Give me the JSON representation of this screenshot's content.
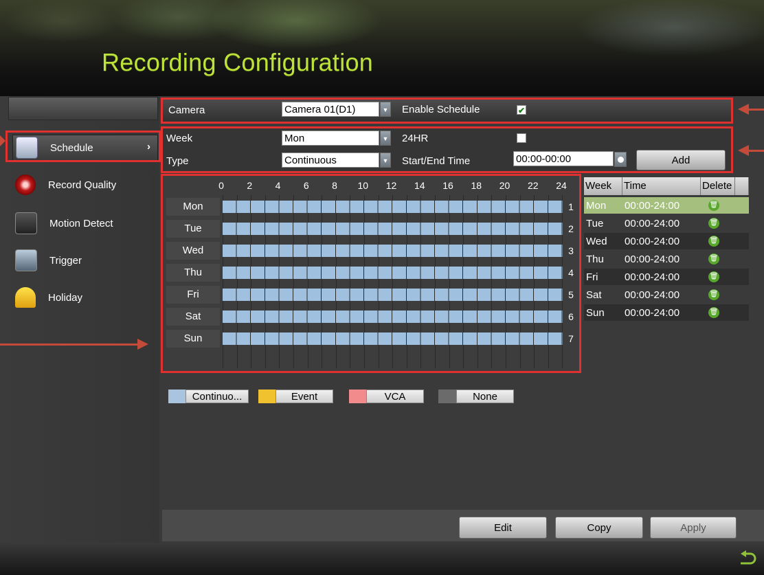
{
  "title": "Recording Configuration",
  "sidebar": {
    "items": [
      {
        "label": "Schedule",
        "icon": "calendar-icon"
      },
      {
        "label": "Record Quality",
        "icon": "record-icon"
      },
      {
        "label": "Motion Detect",
        "icon": "motion-icon"
      },
      {
        "label": "Trigger",
        "icon": "trigger-icon"
      },
      {
        "label": "Holiday",
        "icon": "umbrella-icon"
      }
    ]
  },
  "camera_row": {
    "camera_label": "Camera",
    "camera_value": "Camera 01(D1)",
    "enable_label": "Enable Schedule",
    "enable_checked": true
  },
  "schedule_row": {
    "week_label": "Week",
    "week_value": "Mon",
    "hr24_label": "24HR",
    "type_label": "Type",
    "type_value": "Continuous",
    "time_label": "Start/End Time",
    "time_value": "00:00-00:00",
    "add_label": "Add"
  },
  "grid": {
    "hours": [
      "0",
      "2",
      "4",
      "6",
      "8",
      "10",
      "12",
      "14",
      "16",
      "18",
      "20",
      "22",
      "24"
    ],
    "days": [
      "Mon",
      "Tue",
      "Wed",
      "Thu",
      "Fri",
      "Sat",
      "Sun"
    ],
    "row_numbers": [
      "1",
      "2",
      "3",
      "4",
      "5",
      "6",
      "7"
    ],
    "bar_color": "#9fc0df"
  },
  "table": {
    "headers": {
      "week": "Week",
      "time": "Time",
      "delete": "Delete"
    },
    "rows": [
      {
        "day": "Mon",
        "time": "00:00-24:00"
      },
      {
        "day": "Tue",
        "time": "00:00-24:00"
      },
      {
        "day": "Wed",
        "time": "00:00-24:00"
      },
      {
        "day": "Thu",
        "time": "00:00-24:00"
      },
      {
        "day": "Fri",
        "time": "00:00-24:00"
      },
      {
        "day": "Sat",
        "time": "00:00-24:00"
      },
      {
        "day": "Sun",
        "time": "00:00-24:00"
      }
    ]
  },
  "legend": [
    {
      "label": "Continuo...",
      "color": "#a9c4de"
    },
    {
      "label": "Event",
      "color": "#f0c230"
    },
    {
      "label": "VCA",
      "color": "#f28b8b"
    },
    {
      "label": "None",
      "color": "#6b6b6b"
    }
  ],
  "buttons": {
    "edit": "Edit",
    "copy": "Copy",
    "apply": "Apply"
  },
  "colors": {
    "title": "#bde23a",
    "highlight": "#e03030",
    "selected_row": "#a4bf7e"
  }
}
